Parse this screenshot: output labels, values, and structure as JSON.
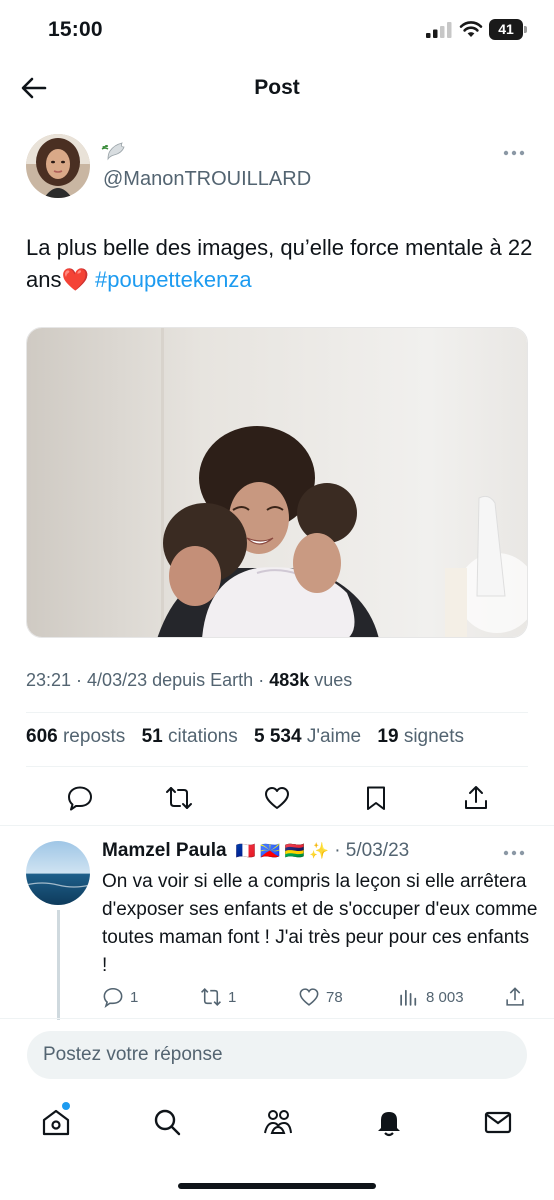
{
  "status_bar": {
    "time": "15:00",
    "battery": "41"
  },
  "nav": {
    "title": "Post"
  },
  "author": {
    "handle": "@ManonTROUILLARD"
  },
  "tweet": {
    "text": "La plus belle des images, qu’elle force mentale à 22 ans",
    "emoji": "❤️",
    "hashtag": "#poupettekenza",
    "time": "23:21",
    "date": "4/03/23",
    "source": "depuis Earth",
    "views_count": "483k",
    "views_label": "vues"
  },
  "stats": {
    "reposts_count": "606",
    "reposts_label": "reposts",
    "quotes_count": "51",
    "quotes_label": "citations",
    "likes_count": "5 534",
    "likes_label": "J'aime",
    "bookmarks_count": "19",
    "bookmarks_label": "signets"
  },
  "reply": {
    "name": "Mamzel Paula",
    "flags": "🇫🇷 🇷🇪 🇲🇺 ✨",
    "date": "· 5/03/23",
    "text": "On va voir si elle a compris la leçon si elle arrêtera d'exposer ses enfants et de s'occuper d'eux comme toutes maman font ! J'ai très peur pour ces enfants !",
    "replies": "1",
    "reposts": "1",
    "likes": "78",
    "views": "8 003"
  },
  "compose": {
    "placeholder": "Postez votre réponse"
  },
  "colors": {
    "accent": "#1d9bf0",
    "text": "#0f1419",
    "muted": "#536471"
  },
  "icons": [
    "back-arrow-icon",
    "dove-icon",
    "more-icon",
    "comment-icon",
    "repost-icon",
    "like-icon",
    "bookmark-icon",
    "share-icon",
    "views-icon",
    "home-icon",
    "search-icon",
    "communities-icon",
    "notifications-icon",
    "messages-icon"
  ]
}
